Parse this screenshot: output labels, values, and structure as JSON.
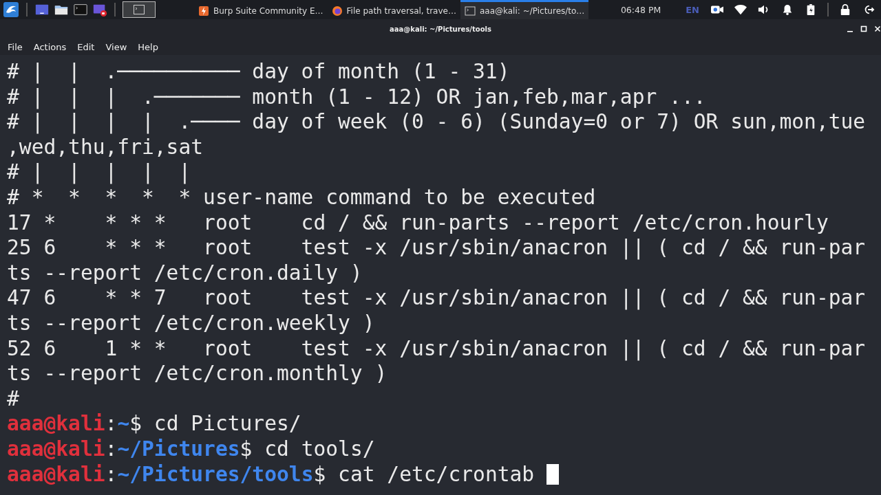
{
  "taskbar": {
    "workspaces": [
      {
        "selected": true
      }
    ],
    "tasks": [
      {
        "kind": "burp",
        "label": "Burp Suite Community E…",
        "selected": false
      },
      {
        "kind": "firefox",
        "label": "File path traversal, trave…",
        "selected": false
      },
      {
        "kind": "terminal",
        "label": "aaa@kali: ~/Pictures/to…",
        "selected": true
      }
    ],
    "clock": "06:48 PM",
    "keyboard_layout": "EN"
  },
  "window": {
    "title": "aaa@kali: ~/Pictures/tools",
    "menu": [
      "File",
      "Actions",
      "Edit",
      "View",
      "Help"
    ]
  },
  "terminal": {
    "lines": [
      {
        "kind": "text",
        "text": "# |  |  .────────── day of month (1 - 31)"
      },
      {
        "kind": "text",
        "text": "# |  |  |  .─────── month (1 - 12) OR jan,feb,mar,apr ..."
      },
      {
        "kind": "text",
        "text": "# |  |  |  |  .──── day of week (0 - 6) (Sunday=0 or 7) OR sun,mon,tue"
      },
      {
        "kind": "text",
        "text": ",wed,thu,fri,sat"
      },
      {
        "kind": "text",
        "text": "# |  |  |  |  |"
      },
      {
        "kind": "text",
        "text": "# *  *  *  *  * user-name command to be executed"
      },
      {
        "kind": "text",
        "text": "17 *    * * *   root    cd / && run-parts --report /etc/cron.hourly"
      },
      {
        "kind": "text",
        "text": "25 6    * * *   root    test -x /usr/sbin/anacron || ( cd / && run-par"
      },
      {
        "kind": "text",
        "text": "ts --report /etc/cron.daily )"
      },
      {
        "kind": "text",
        "text": "47 6    * * 7   root    test -x /usr/sbin/anacron || ( cd / && run-par"
      },
      {
        "kind": "text",
        "text": "ts --report /etc/cron.weekly )"
      },
      {
        "kind": "text",
        "text": "52 6    1 * *   root    test -x /usr/sbin/anacron || ( cd / && run-par"
      },
      {
        "kind": "text",
        "text": "ts --report /etc/cron.monthly )"
      },
      {
        "kind": "text",
        "text": "#"
      },
      {
        "kind": "prompt",
        "user": "aaa@kali",
        "separator": ":",
        "path": "~",
        "command": "$ cd Pictures/",
        "cursor": false
      },
      {
        "kind": "prompt",
        "user": "aaa@kali",
        "separator": ":",
        "path": "~/Pictures",
        "command": "$ cd tools/",
        "cursor": false
      },
      {
        "kind": "prompt",
        "user": "aaa@kali",
        "separator": ":",
        "path": "~/Pictures/tools",
        "command": "$ cat /etc/crontab ",
        "cursor": true
      }
    ]
  }
}
